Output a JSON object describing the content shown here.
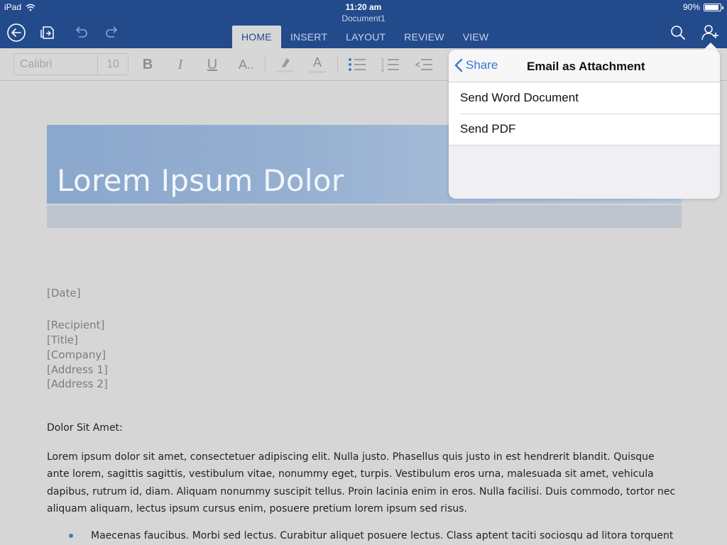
{
  "status": {
    "device": "iPad",
    "time": "11:20 am",
    "battery": "90%"
  },
  "document": {
    "title": "Document1"
  },
  "ribbon": {
    "tabs": [
      {
        "label": "HOME",
        "active": true
      },
      {
        "label": "INSERT"
      },
      {
        "label": "LAYOUT"
      },
      {
        "label": "REVIEW"
      },
      {
        "label": "VIEW"
      }
    ]
  },
  "toolbar": {
    "font_name": "Calibri",
    "font_size": "10",
    "bold": "B",
    "italic": "I",
    "underline": "U",
    "more_text_formats": "A..",
    "font_color": "A"
  },
  "page": {
    "heading": "Lorem Ipsum Dolor",
    "date": "[Date]",
    "recipient_lines": [
      "[Recipient]",
      "[Title]",
      "[Company]",
      "[Address 1]",
      "[Address 2]"
    ],
    "salutation": "Dolor Sit Amet:",
    "paragraph": "Lorem ipsum dolor sit amet, consectetuer adipiscing elit. Nulla justo. Phasellus quis justo in est hendrerit blandit. Quisque ante lorem, sagittis sagittis, vestibulum vitae, nonummy eget, turpis. Vestibulum eros urna, malesuada sit amet, vehicula dapibus, rutrum id, diam. Aliquam nonummy suscipit tellus. Proin lacinia enim in eros. Nulla facilisi. Duis commodo, tortor nec aliquam aliquam, lectus ipsum cursus enim, posuere pretium lorem ipsum sed risus.",
    "bullet": "Maecenas faucibus. Morbi sed lectus. Curabitur aliquet posuere lectus. Class aptent taciti sociosqu ad litora torquent"
  },
  "popover": {
    "back_label": "Share",
    "title": "Email as Attachment",
    "items": [
      {
        "label": "Send Word Document"
      },
      {
        "label": "Send PDF"
      }
    ]
  },
  "colors": {
    "header_bg": "#234b8c",
    "accent": "#3478d6"
  }
}
